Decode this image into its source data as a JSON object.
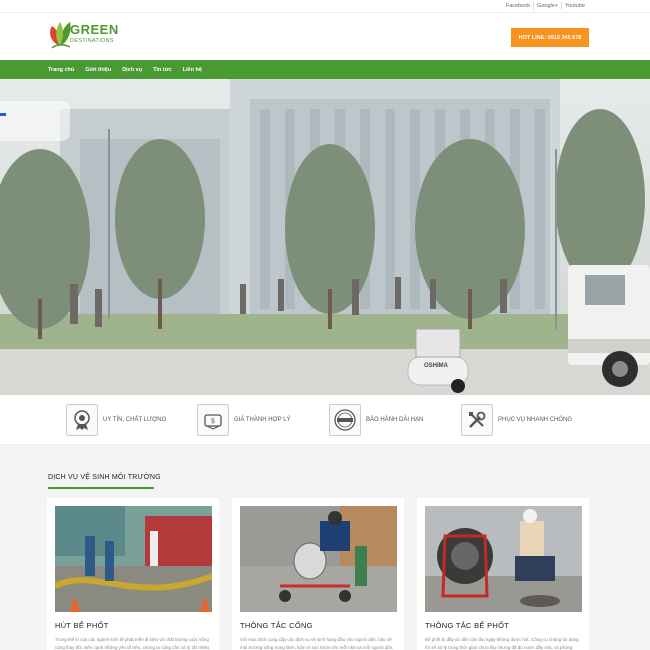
{
  "topbar": {
    "social": [
      "Facebook",
      "Google+",
      "Youtube"
    ]
  },
  "header": {
    "logo_line1": "GREEN",
    "logo_line2": "DESTINATIONS",
    "hotline": "HOT LINE: 0912 345 678"
  },
  "nav": {
    "items": [
      "Trang chủ",
      "Giới thiệu",
      "Dịch vụ",
      "Tin tức",
      "Liên hệ"
    ]
  },
  "hero": {
    "machine_label": "OSHIMA"
  },
  "features": [
    {
      "label": "UY TÍN, CHẤT LƯỢNG",
      "icon": "medal-icon"
    },
    {
      "label": "GIÁ THÀNH HỢP LÝ",
      "icon": "price-tag-icon"
    },
    {
      "label": "BẢO HÀNH DÀI HẠN",
      "icon": "guarantee-seal-icon"
    },
    {
      "label": "PHỤC VỤ NHANH CHÓNG",
      "icon": "tools-icon"
    }
  ],
  "services": {
    "title": "DỊCH VỤ VỆ SINH MÔI TRƯỜNG",
    "cards": [
      {
        "title": "HÚT BỂ PHỐT",
        "text": "Trong thế kỉ của các ngành kinh tế phát triển đi kèm và chất lượng cuộc sống cũng thay đổi. Bên cạnh những yếu tố trên, chúng ta cũng cần xử lý rất nhiều mục. Và sau một thời gian sử dụng thì bể phốt nhà bạn cần được hút..."
      },
      {
        "title": "THÔNG TẮC CỐNG",
        "text": "Với mục đích cung cấp các dịch vụ vệ sinh hàng đầu cho người dân, bảo vệ môi trường sống trong lành, luôn vì sức khỏe cho mỗi nhà và mỗi người dân, chúng tôi cam kết..."
      },
      {
        "title": "THÔNG TẮC BỂ PHỐT",
        "text": "Bể phốt bị đầy do dồn cặn lâu ngày không được hút. Công cụ chúng tôi dùng thì sẽ xử lý trong thời gian chưa lâu nhưng đã đủ nước đầy rửa, và phòng ngừa cho mỗi..."
      }
    ]
  },
  "colors": {
    "brand_green": "#4a9a34",
    "accent_orange": "#f7941d"
  }
}
